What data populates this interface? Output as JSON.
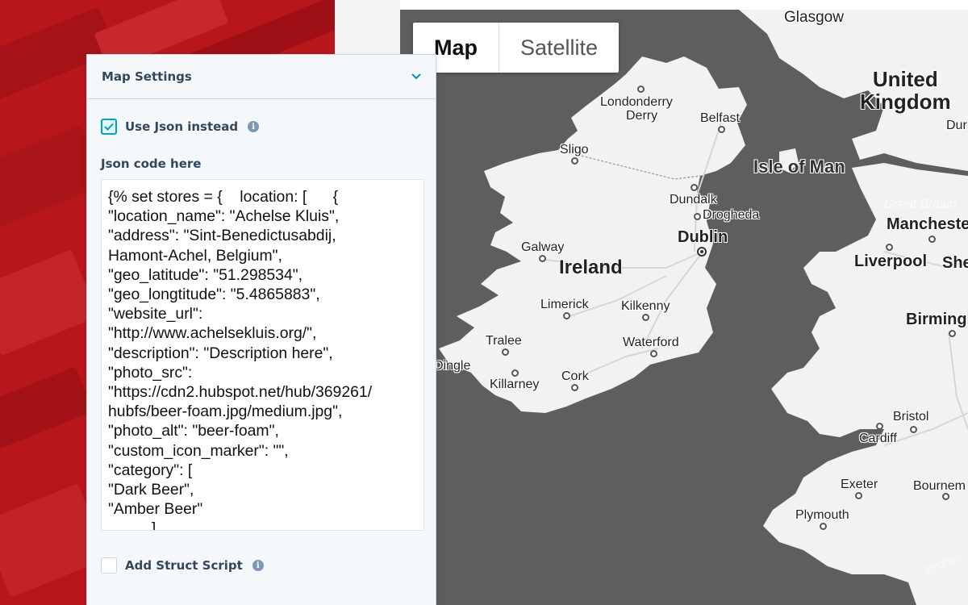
{
  "panel": {
    "title": "Map Settings",
    "chevron_icon": "chevron-down-icon",
    "use_json": {
      "label": "Use Json instead",
      "checked": true,
      "info_icon": "info-icon"
    },
    "json_field": {
      "label": "Json code here",
      "value": "{% set stores = {    location: [      {\n\"location_name\": \"Achelse Kluis\",\n\"address\": \"Sint-Benedictusabdij,\nHamont-Achel, Belgium\",\n\"geo_latitude\": \"51.298534\",\n\"geo_longtitude\": \"5.4865883\",\n\"website_url\":\n\"http://www.achelsekluis.org/\",\n\"description\": \"Description here\",\n\"photo_src\":\n\"https://cdn2.hubspot.net/hub/369261/\nhubfs/beer-foam.jpg/medium.jpg\",\n\"photo_alt\": \"beer-foam\",\n\"custom_icon_marker\": \"\",\n\"category\": [\n\"Dark Beer\",\n\"Amber Beer\"\n          ]"
    },
    "struct_script": {
      "label": "Add Struct Script",
      "checked": false,
      "info_icon": "info-icon"
    }
  },
  "map": {
    "type_control": {
      "map_label": "Map",
      "satellite_label": "Satellite",
      "active": "Map"
    },
    "labels": {
      "glasgow": "Glasgow",
      "uk": "United\nKingdom",
      "durham": "Dur",
      "londonderry": "Londonderry",
      "derry": "Derry",
      "belfast": "Belfast",
      "sligo": "Sligo",
      "isle_of_man": "Isle of Man",
      "dundalk": "Dundalk",
      "drogheda": "Drogheda",
      "great_britain": "Great Britain",
      "manchester": "Manchester",
      "galway": "Galway",
      "dublin": "Dublin",
      "ireland": "Ireland",
      "liverpool": "Liverpool",
      "sheffield": "She",
      "limerick": "Limerick",
      "kilkenny": "Kilkenny",
      "birmingham": "Birmingh",
      "tralee": "Tralee",
      "waterford": "Waterford",
      "dingle": "Dingle",
      "killarney": "Killarney",
      "cork": "Cork",
      "bristol": "Bristol",
      "cardiff": "Cardiff",
      "exeter": "Exeter",
      "bournemouth": "Bournem",
      "plymouth": "Plymouth",
      "attribution": "English"
    },
    "colors": {
      "sea": "#5e5e5e",
      "land": "#f2f2f2",
      "roads": "#d9d9d9"
    }
  },
  "background": {
    "color": "#b8161b"
  }
}
